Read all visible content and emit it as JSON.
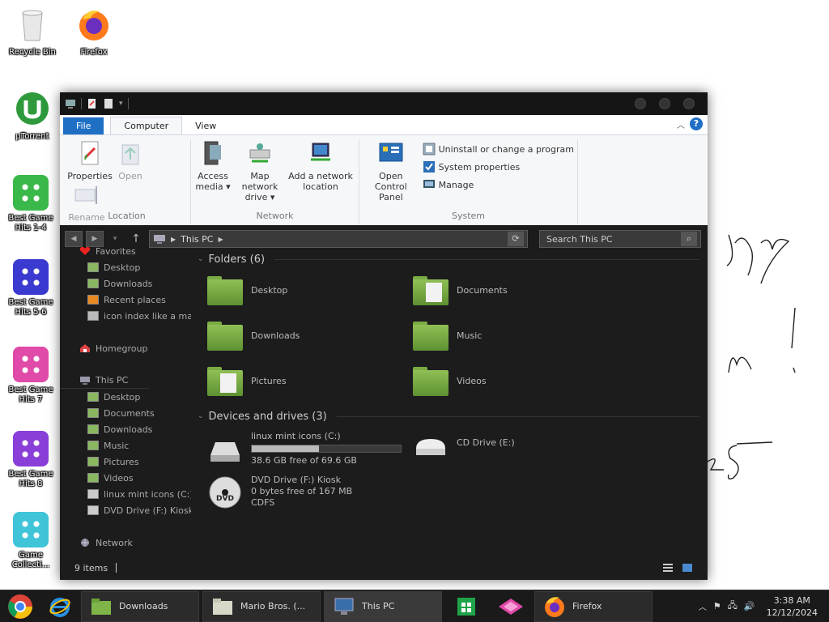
{
  "desktop_icons": [
    {
      "label": "Recycle Bin",
      "icon": "recycle-bin-icon"
    },
    {
      "label": "Firefox",
      "icon": "firefox-icon"
    },
    {
      "label": "µTorrent",
      "icon": "utorrent-icon"
    },
    {
      "label": "Best Game Hits 1-4",
      "icon": "dice-icon"
    },
    {
      "label": "Best Game Hits 5-6",
      "icon": "dice-icon"
    },
    {
      "label": "Best Game Hits 7",
      "icon": "dice-icon"
    },
    {
      "label": "Best Game Hits 8",
      "icon": "dice-icon"
    },
    {
      "label": "Game Collecti...",
      "icon": "dice-icon"
    }
  ],
  "window": {
    "ribbon_tabs": [
      "File",
      "Computer",
      "View"
    ],
    "ribbon": {
      "location": {
        "label": "Location",
        "properties": "Properties",
        "open": "Open",
        "rename": "Rename"
      },
      "network": {
        "label": "Network",
        "access_media_1": "Access",
        "access_media_2": "media ▾",
        "map_drive_1": "Map network",
        "map_drive_2": "drive ▾",
        "add_location_1": "Add a network",
        "add_location_2": "location"
      },
      "system": {
        "label": "System",
        "control_panel_1": "Open Control",
        "control_panel_2": "Panel",
        "uninstall": "Uninstall or change a program",
        "system_properties": "System properties",
        "manage": "Manage"
      }
    },
    "address": {
      "path": "This PC",
      "search_placeholder": "Search This PC"
    },
    "nav": {
      "favorites": "Favorites",
      "favorites_items": [
        "Desktop",
        "Downloads",
        "Recent places",
        "icon index like a mac"
      ],
      "homegroup": "Homegroup",
      "this_pc": "This PC",
      "this_pc_items": [
        "Desktop",
        "Documents",
        "Downloads",
        "Music",
        "Pictures",
        "Videos",
        "linux mint icons (C:)",
        "DVD Drive (F:) Kiosk"
      ],
      "network": "Network"
    },
    "folders_header": "Folders (6)",
    "folders": [
      "Desktop",
      "Documents",
      "Downloads",
      "Music",
      "Pictures",
      "Videos"
    ],
    "drives_header": "Devices and drives (3)",
    "drives": [
      {
        "name": "linux mint icons (C:)",
        "free": "38.6 GB free of 69.6 GB",
        "used_fraction": 0.45
      },
      {
        "name": "CD Drive (E:)"
      },
      {
        "name": "DVD Drive (F:) Kiosk",
        "free": "0 bytes free of 167 MB",
        "fs": "CDFS"
      }
    ],
    "status": "9 items"
  },
  "taskbar": {
    "items": [
      "Downloads",
      "Mario Bros. (...",
      "This PC",
      "Firefox"
    ],
    "time": "3:38 AM",
    "date": "12/12/2024"
  },
  "colors": {
    "accent": "#1f6fc5",
    "folder_green": "#6fa33d",
    "window_bg": "#1c1c1c"
  }
}
